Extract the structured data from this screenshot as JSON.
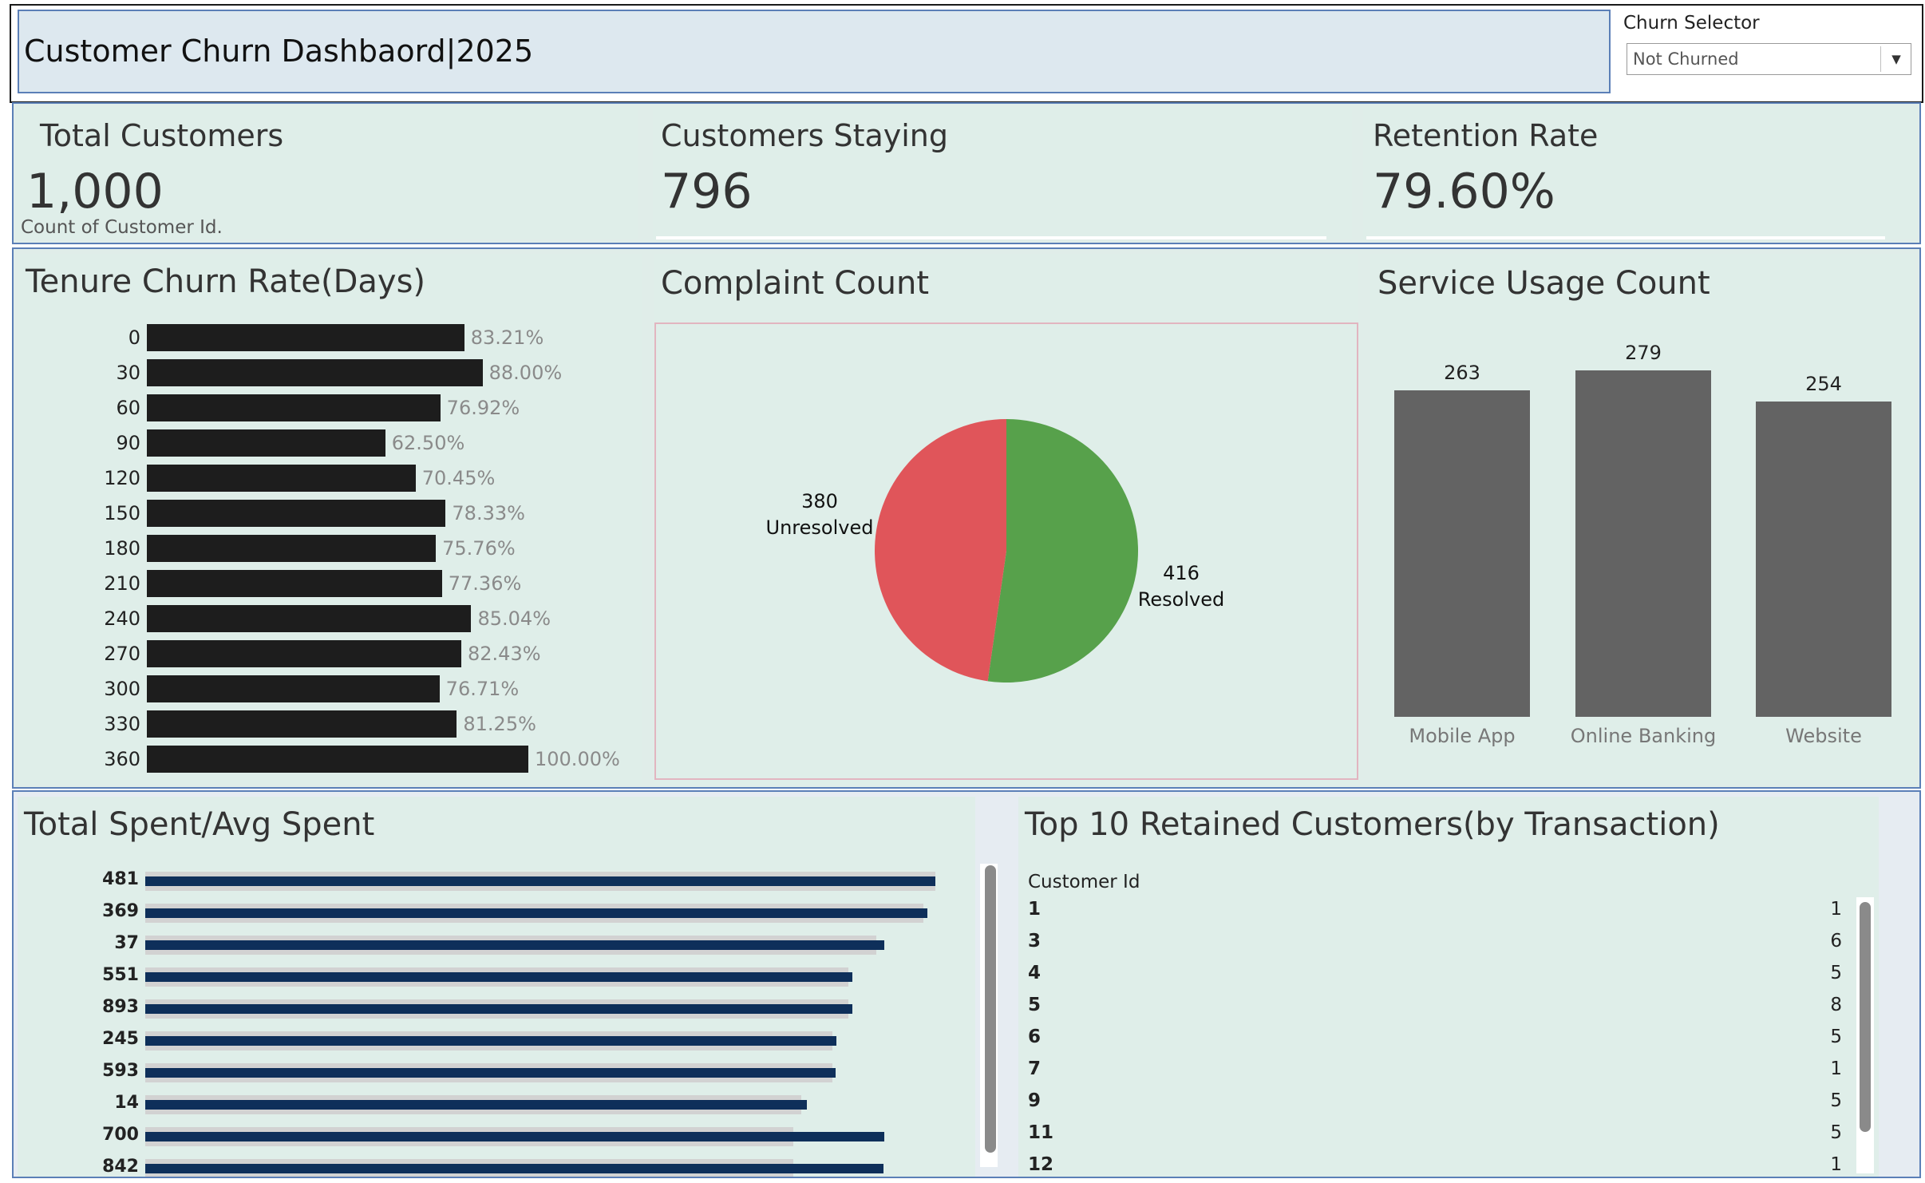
{
  "header": {
    "title": "Customer Churn Dashbaord|2025",
    "selector_label": "Churn Selector",
    "selector_value": "Not Churned"
  },
  "kpis": [
    {
      "title": "Total Customers",
      "value": "1,000",
      "caption": "Count of Customer Id."
    },
    {
      "title": "Customers Staying",
      "value": "796"
    },
    {
      "title": "Retention Rate",
      "value": "79.60%"
    }
  ],
  "tenure": {
    "title": "Tenure Churn Rate(Days)"
  },
  "complaint": {
    "title": "Complaint Count"
  },
  "service": {
    "title": "Service Usage Count"
  },
  "spent": {
    "title": "Total Spent/Avg Spent"
  },
  "top10": {
    "title": "Top 10 Retained Customers(by Transaction)",
    "column_header": "Customer Id",
    "rows": [
      {
        "id": "1",
        "value": "1"
      },
      {
        "id": "3",
        "value": "6"
      },
      {
        "id": "4",
        "value": "5"
      },
      {
        "id": "5",
        "value": "8"
      },
      {
        "id": "6",
        "value": "5"
      },
      {
        "id": "7",
        "value": "1"
      },
      {
        "id": "9",
        "value": "5"
      },
      {
        "id": "11",
        "value": "5"
      },
      {
        "id": "12",
        "value": "1"
      }
    ]
  },
  "colors": {
    "resolved": "#57a14b",
    "unresolved": "#e0555a",
    "tenure_bar": "#1d1d1d",
    "service_bar": "#636363",
    "spent_total": "#0e2f5a",
    "spent_avg": "#d2d2d2",
    "panel_bg": "#dfeee9",
    "title_bg": "#dde8ef",
    "border_blue": "#5b7fb7"
  },
  "chart_data": [
    {
      "type": "bar",
      "orientation": "horizontal",
      "title": "Tenure Churn Rate(Days)",
      "categories": [
        "0",
        "30",
        "60",
        "90",
        "120",
        "150",
        "180",
        "210",
        "240",
        "270",
        "300",
        "330",
        "360"
      ],
      "values": [
        83.21,
        88.0,
        76.92,
        62.5,
        70.45,
        78.33,
        75.76,
        77.36,
        85.04,
        82.43,
        76.71,
        81.25,
        100.0
      ],
      "labels": [
        "83.21%",
        "88.00%",
        "76.92%",
        "62.50%",
        "70.45%",
        "78.33%",
        "75.76%",
        "77.36%",
        "85.04%",
        "82.43%",
        "76.71%",
        "81.25%",
        "100.00%"
      ],
      "xlim": [
        0,
        100
      ]
    },
    {
      "type": "pie",
      "title": "Complaint Count",
      "slices": [
        {
          "name": "Resolved",
          "value": 416,
          "color": "#57a14b"
        },
        {
          "name": "Unresolved",
          "value": 380,
          "color": "#e0555a"
        }
      ]
    },
    {
      "type": "bar",
      "title": "Service Usage Count",
      "categories": [
        "Mobile App",
        "Online Banking",
        "Website"
      ],
      "values": [
        263,
        279,
        254
      ],
      "ylim": [
        0,
        279
      ]
    },
    {
      "type": "bar",
      "orientation": "horizontal",
      "title": "Total Spent/Avg Spent",
      "categories": [
        "481",
        "369",
        "37",
        "551",
        "893",
        "245",
        "593",
        "14",
        "700",
        "842"
      ],
      "series": [
        {
          "values": [
            100,
            99,
            93.5,
            89.5,
            89.5,
            87.5,
            87.4,
            83.7,
            93.5,
            93.4
          ]
        },
        {
          "values": [
            100,
            98.5,
            92.5,
            89,
            89,
            87,
            87,
            83,
            82,
            82
          ]
        }
      ],
      "xlim": [
        0,
        100
      ]
    }
  ]
}
